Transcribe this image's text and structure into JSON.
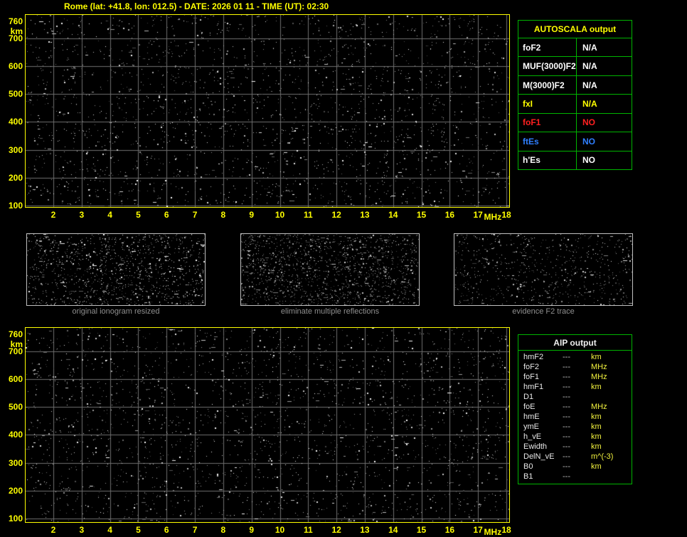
{
  "header": {
    "title": "Rome (lat: +41.8, lon: 012.5) - DATE: 2026 01 11 - TIME (UT): 02:30"
  },
  "axes": {
    "y_unit": "km",
    "y_values": [
      "760",
      "700",
      "600",
      "500",
      "400",
      "300",
      "200",
      "100"
    ],
    "y_km": [
      760,
      700,
      600,
      500,
      400,
      300,
      200,
      100
    ],
    "x_values": [
      "2",
      "3",
      "4",
      "5",
      "6",
      "7",
      "8",
      "9",
      "10",
      "11",
      "12",
      "13",
      "14",
      "15",
      "16",
      "17",
      "18"
    ],
    "x_unit": "MHz"
  },
  "autoscala": {
    "title": "AUTOSCALA output",
    "rows": [
      {
        "param": "foF2",
        "value": "N/A",
        "color": "#ffffff"
      },
      {
        "param": "MUF(3000)F2",
        "value": "N/A",
        "color": "#ffffff"
      },
      {
        "param": "M(3000)F2",
        "value": "N/A",
        "color": "#ffffff"
      },
      {
        "param": "fxI",
        "value": "N/A",
        "color": "#ffff00"
      },
      {
        "param": "foF1",
        "value": "NO",
        "color": "#ff2020"
      },
      {
        "param": "ftEs",
        "value": "NO",
        "color": "#2f7fff"
      },
      {
        "param": "h'Es",
        "value": "NO",
        "color": "#ffffff"
      }
    ]
  },
  "panels": [
    {
      "label": "original ionogram resized"
    },
    {
      "label": "eliminate multiple reflections"
    },
    {
      "label": "evidence F2 trace"
    }
  ],
  "aip": {
    "title": "AIP output",
    "rows": [
      {
        "param": "hmF2",
        "value": "---",
        "unit": "km"
      },
      {
        "param": "foF2",
        "value": "---",
        "unit": "MHz"
      },
      {
        "param": "foF1",
        "value": "---",
        "unit": "MHz"
      },
      {
        "param": "hmF1",
        "value": "---",
        "unit": "km"
      },
      {
        "param": "D1",
        "value": "---",
        "unit": ""
      },
      {
        "param": "foE",
        "value": "---",
        "unit": "MHz"
      },
      {
        "param": "hmE",
        "value": "---",
        "unit": "km"
      },
      {
        "param": "ymE",
        "value": "---",
        "unit": "km"
      },
      {
        "param": "h_vE",
        "value": "---",
        "unit": "km"
      },
      {
        "param": "Ewidth",
        "value": "---",
        "unit": "km"
      },
      {
        "param": "DelN_vE",
        "value": "---",
        "unit": "m^(-3)"
      },
      {
        "param": "B0",
        "value": "---",
        "unit": "km"
      },
      {
        "param": "B1",
        "value": "---",
        "unit": ""
      }
    ]
  },
  "colors": {
    "accent_yellow": "#ffff00",
    "table_border_green": "#00b400",
    "grid_gray": "#6f6f6f",
    "panel_label_gray": "#8f8f8f",
    "text_white": "#ffffff",
    "status_red": "#ff2020",
    "status_blue": "#2f7fff",
    "aip_unit_yellow": "#f2f23e"
  }
}
